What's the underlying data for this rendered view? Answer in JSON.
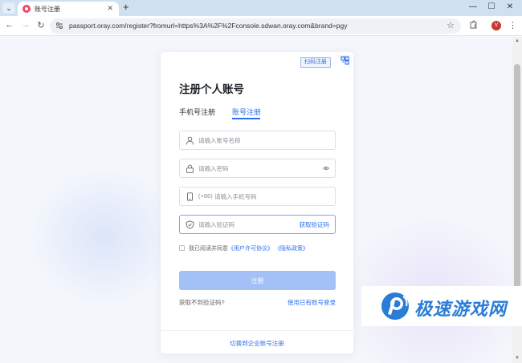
{
  "browser": {
    "tab_title": "账号注册",
    "tab_menu_glyph": "⌄",
    "url": "passport.oray.com/register?fromurl=https%3A%2F%2Fconsole.sdwan.oray.com&brand=pgy",
    "profile_initial": "V"
  },
  "card": {
    "qr_tip": "扫码注册",
    "title": "注册个人账号",
    "tabs": {
      "phone": "手机号注册",
      "account": "账号注册"
    },
    "fields": {
      "account_placeholder": "请输入账号名称",
      "password_placeholder": "请输入密码",
      "phone_prefix": "(+86)",
      "phone_placeholder": "请输入手机号码",
      "code_placeholder": "请输入验证码",
      "get_code": "获取验证码"
    },
    "agreement": {
      "text": "我已阅读并同意",
      "terms": "《用户许可协议》",
      "privacy": "《隐私政策》"
    },
    "submit": "注册",
    "no_code": "获取不到验证码?",
    "use_existing": "使用已有账号登录",
    "switch_enterprise": "切换到企业账号注册"
  },
  "watermark": {
    "text": "极速游戏网"
  },
  "colors": {
    "accent": "#2d6ff0",
    "button_disabled": "#a3c1f7"
  }
}
